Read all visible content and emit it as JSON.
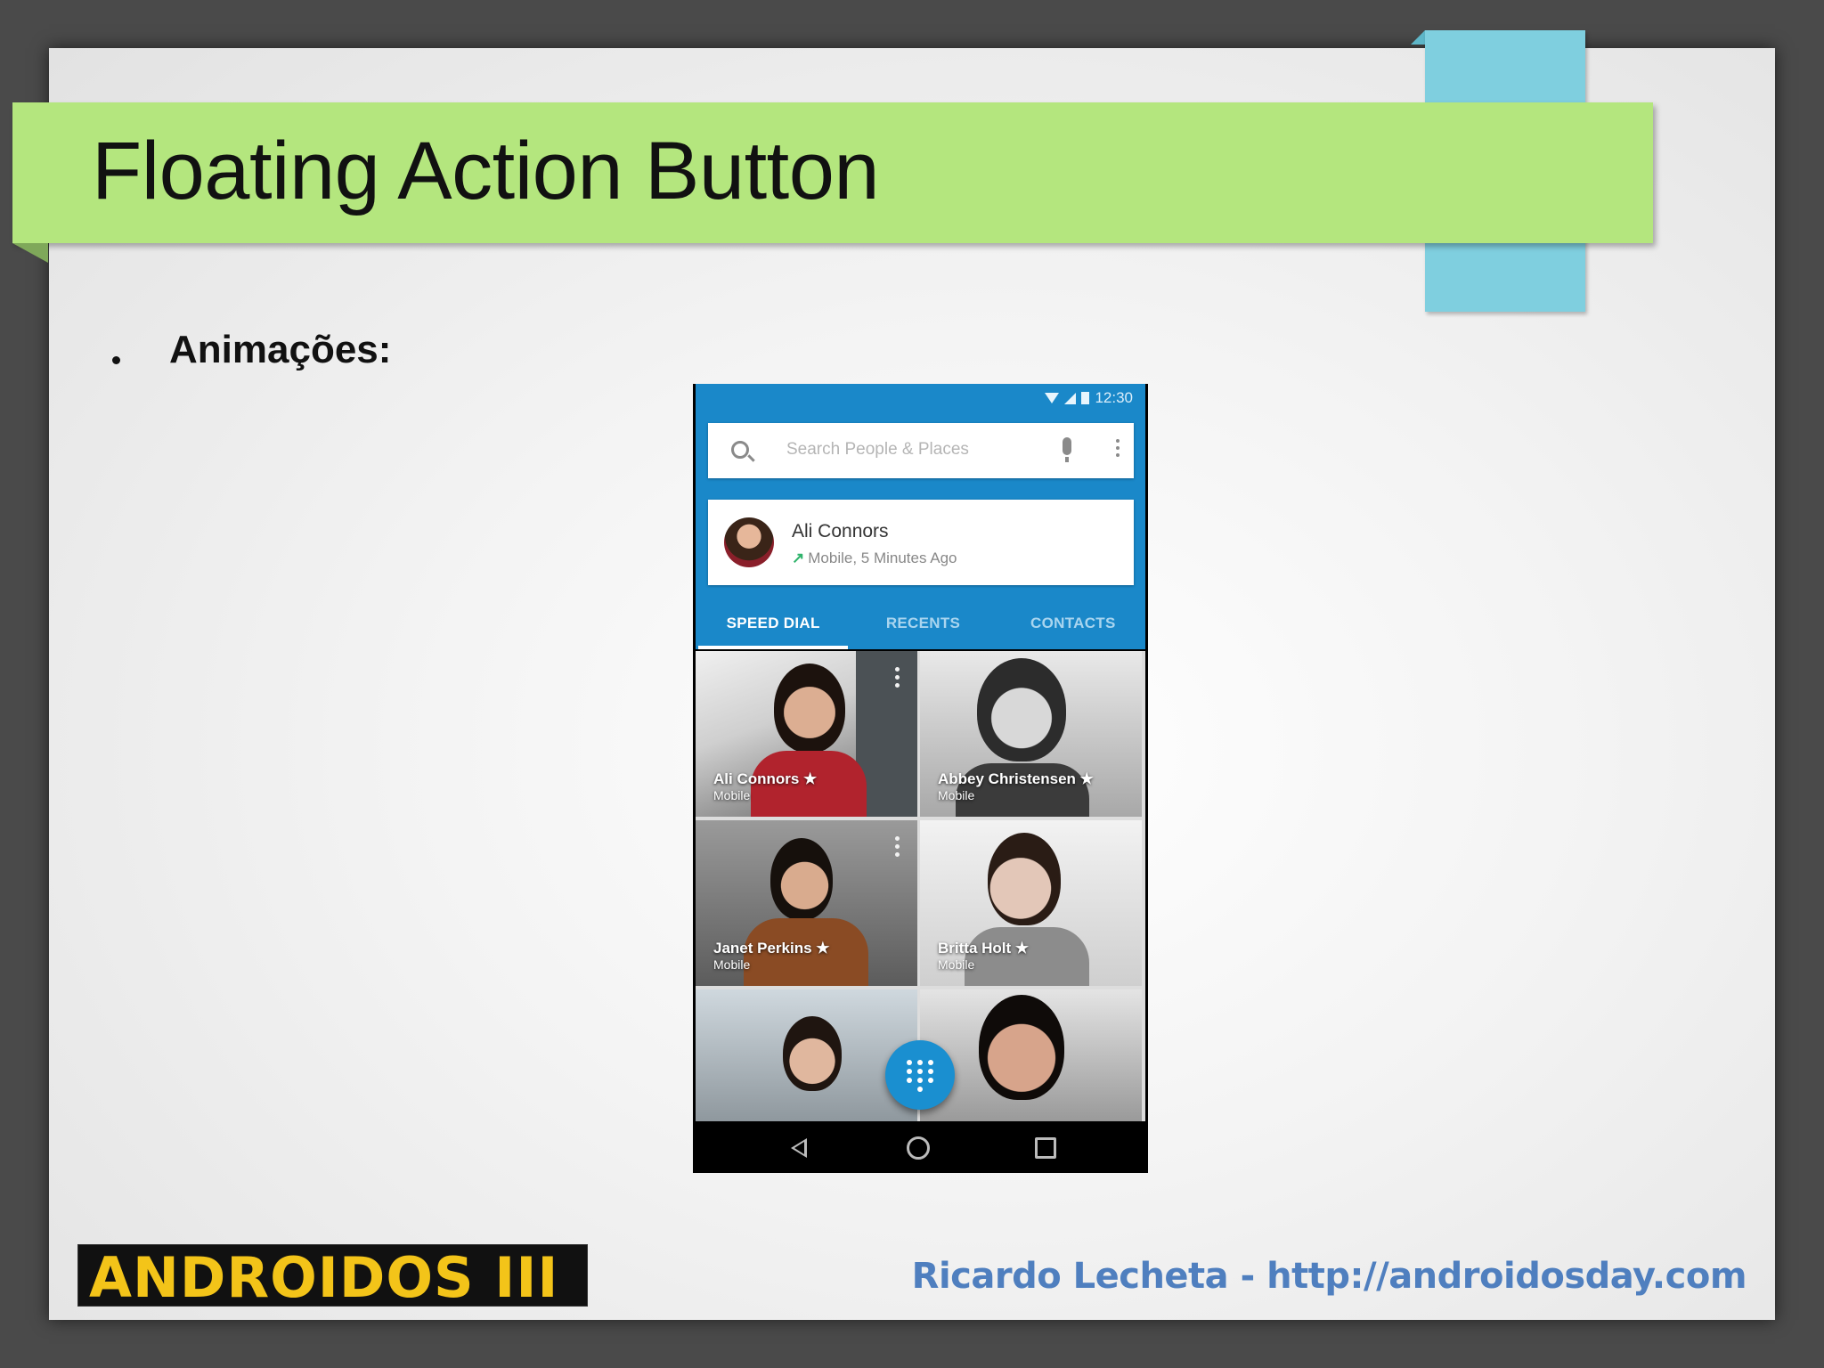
{
  "slide": {
    "title": "Floating Action Button",
    "bullet": "Animações:",
    "logo_text": "ANDROIDOS III",
    "footer": "Ricardo Lecheta - http://androidosday.com",
    "colors": {
      "title_bar": "#b4e67e",
      "tab_accent": "#7fcfdf",
      "footer_text": "#4f7fbf",
      "logo_text": "#f3c419"
    }
  },
  "phone": {
    "status_time": "12:30",
    "search_placeholder": "Search People & Places",
    "recent_contact": {
      "name": "Ali Connors",
      "detail": "Mobile, 5 Minutes Ago"
    },
    "tabs": [
      {
        "label": "SPEED DIAL",
        "active": true
      },
      {
        "label": "RECENTS",
        "active": false
      },
      {
        "label": "CONTACTS",
        "active": false
      }
    ],
    "contacts": [
      {
        "name": "Ali Connors ★",
        "type": "Mobile"
      },
      {
        "name": "Abbey Christensen ★",
        "type": "Mobile"
      },
      {
        "name": "Janet Perkins ★",
        "type": "Mobile"
      },
      {
        "name": "Britta Holt ★",
        "type": "Mobile"
      }
    ],
    "fab_icon": "dialpad-icon",
    "nav_icons": [
      "back-icon",
      "home-icon",
      "recents-icon"
    ],
    "colors": {
      "header": "#1a88c9",
      "fab": "#1a8fd0"
    }
  }
}
